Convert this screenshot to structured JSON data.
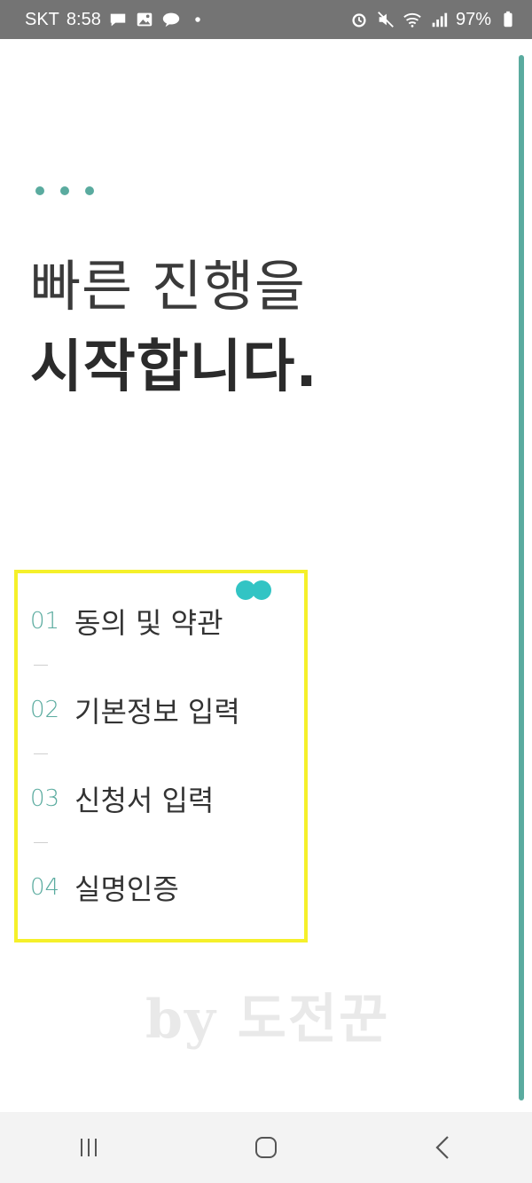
{
  "status_bar": {
    "carrier": "SKT",
    "time": "8:58",
    "battery": "97%",
    "left_icons": [
      "chat-bubble-icon",
      "gallery-icon",
      "kakaotalk-icon",
      "dot-indicator-icon"
    ],
    "right_icons": [
      "alarm-icon",
      "mute-icon",
      "wifi-icon",
      "signal-icon",
      "battery-icon"
    ]
  },
  "header": {
    "title_line1": "빠른 진행을",
    "title_line2": "시작합니다."
  },
  "steps": [
    {
      "num": "01",
      "label": "동의 및 약관"
    },
    {
      "num": "02",
      "label": "기본정보 입력"
    },
    {
      "num": "03",
      "label": "신청서 입력"
    },
    {
      "num": "04",
      "label": "실명인증"
    }
  ],
  "watermark": "by 도전꾼",
  "colors": {
    "accent": "#5aab9f",
    "highlight": "#f5f02a",
    "mini_dots": "#32c4c4",
    "status_bar": "#747474"
  },
  "nav_bar": {
    "buttons": [
      "recent-apps-icon",
      "home-icon",
      "back-icon"
    ]
  }
}
